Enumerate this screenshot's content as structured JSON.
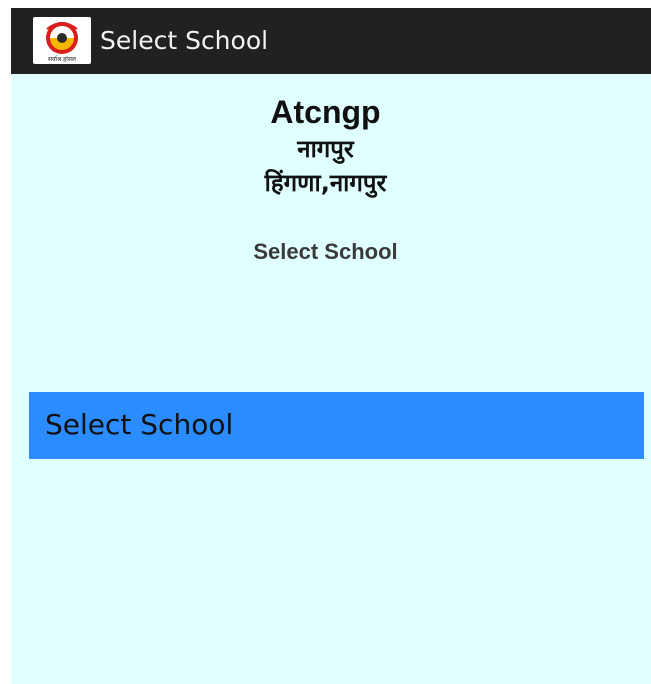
{
  "app_bar": {
    "title": "Select School",
    "icon": "app-logo-icon",
    "logo_text": "सर्वाश्र हांसल"
  },
  "header": {
    "school_name": "Atcngp",
    "city": "नागपुर",
    "area": "हिंगणा,नागपुर"
  },
  "subheading": "Select School",
  "school_spinner": {
    "selected_value": "Select School"
  },
  "colors": {
    "action_bar": "#212121",
    "background": "#e0ffff",
    "spinner": "#2a8cff",
    "logo_red": "#d91e1e",
    "logo_yellow": "#f5b800"
  }
}
